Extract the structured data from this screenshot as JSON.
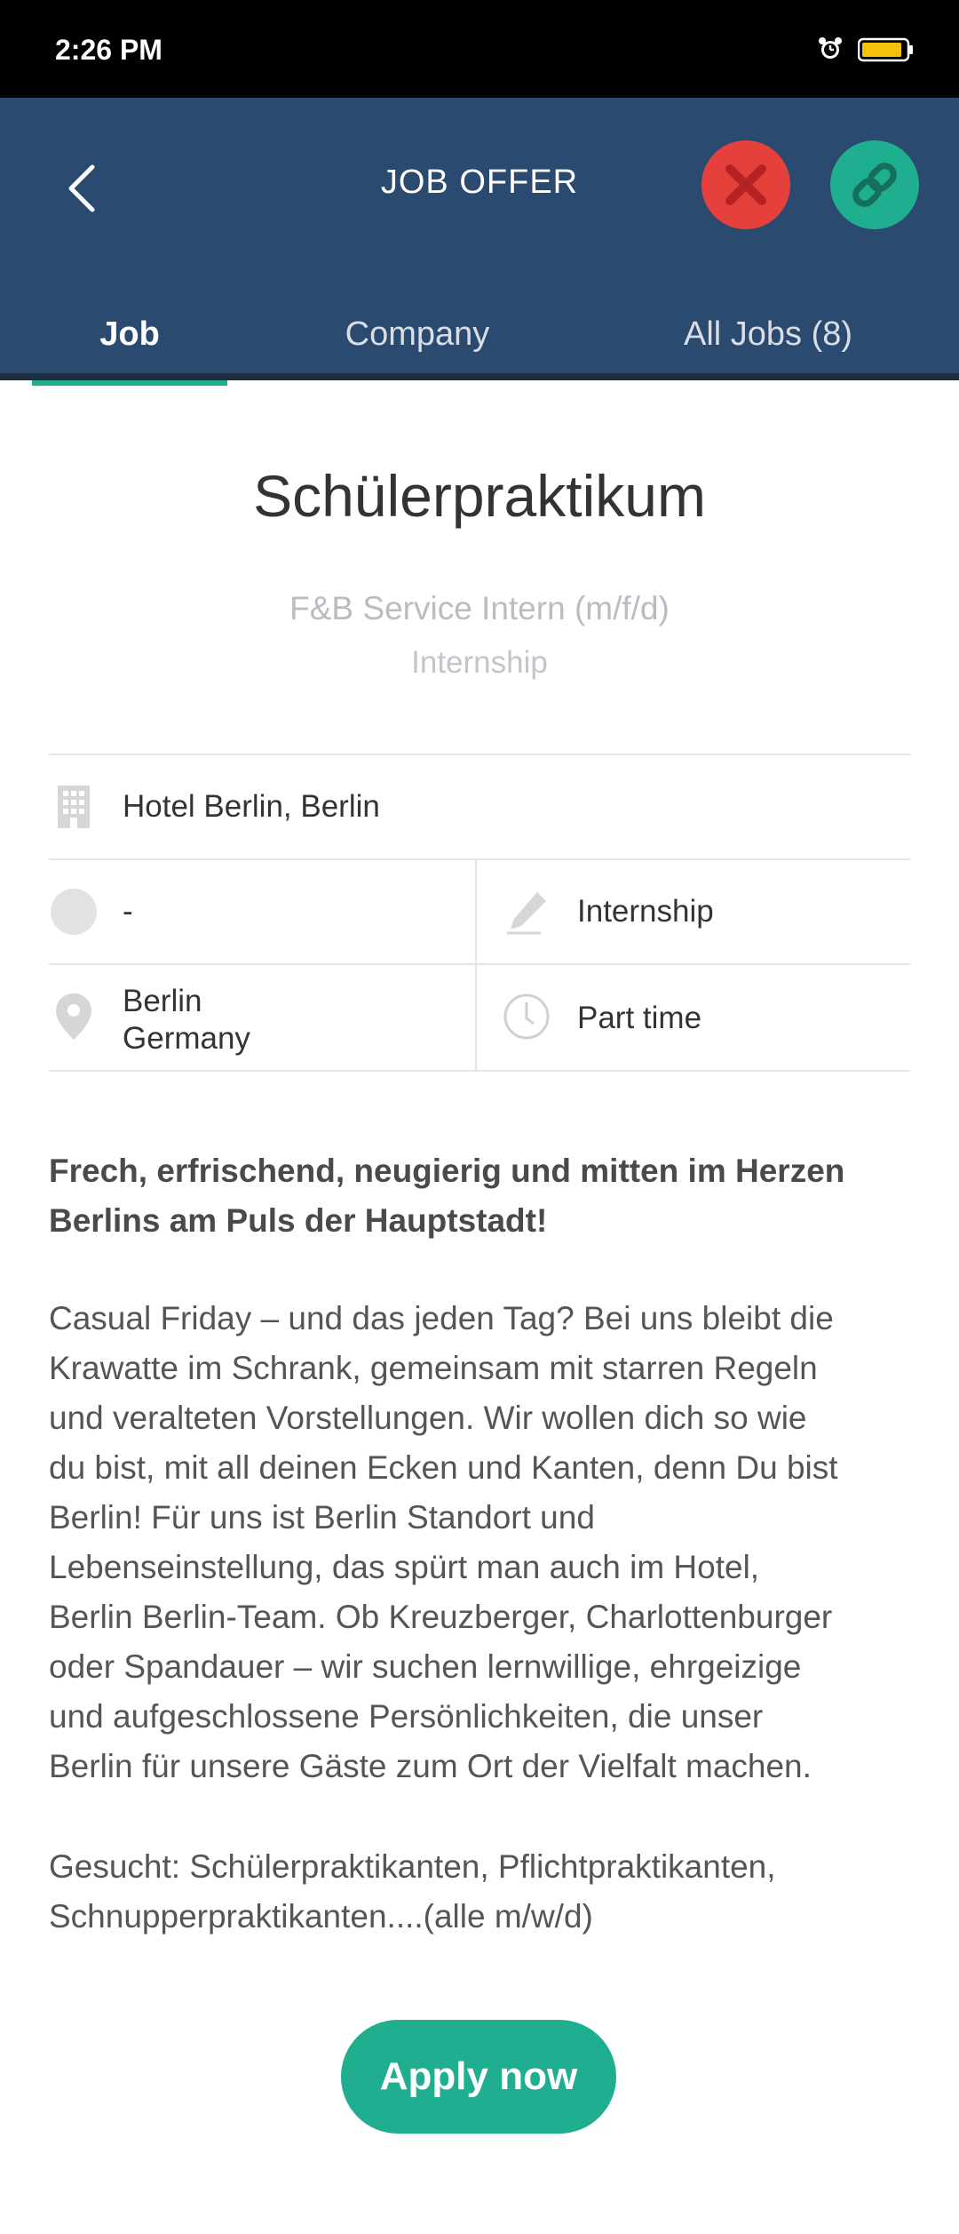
{
  "status_bar": {
    "time": "2:26 PM",
    "alarm_icon": "alarm-icon",
    "battery_icon": "battery-icon"
  },
  "header": {
    "title": "JOB OFFER",
    "back_icon": "chevron-left-icon",
    "close_icon": "close-icon",
    "link_icon": "link-icon",
    "colors": {
      "bar": "#2b4a6f",
      "close": "#e6403c",
      "link": "#1fae8f",
      "accent": "#1fae8f"
    }
  },
  "tabs": [
    {
      "label": "Job",
      "active": true
    },
    {
      "label": "Company",
      "active": false
    },
    {
      "label": "All Jobs (8)",
      "active": false
    }
  ],
  "job": {
    "title": "Schülerpraktikum",
    "subtitle": "F&B Service Intern (m/f/d)",
    "type": "Internship"
  },
  "info": {
    "hotel": {
      "icon": "building-icon",
      "text": "Hotel Berlin, Berlin"
    },
    "salary": {
      "icon": "coin-icon",
      "text": "-"
    },
    "contract": {
      "icon": "pen-icon",
      "text": "Internship"
    },
    "location": {
      "icon": "location-pin-icon",
      "line1": "Berlin",
      "line2": "Germany"
    },
    "hours": {
      "icon": "clock-icon",
      "text": "Part time"
    }
  },
  "description": {
    "headline_line1": "Frech, erfrischend, neugierig und mitten im Herzen",
    "headline_line2": "Berlins am Puls der Hauptstadt!",
    "body_lines": [
      "Casual Friday – und das jeden Tag? Bei uns bleibt die",
      "Krawatte im Schrank, gemeinsam mit starren Regeln",
      "und veralteten Vorstellungen. Wir wollen dich so wie",
      "du bist, mit all deinen Ecken und Kanten, denn Du bist",
      "Berlin! Für uns ist Berlin Standort und",
      "Lebenseinstellung, das spürt man auch im Hotel,",
      "Berlin Berlin-Team. Ob Kreuzberger, Charlottenburger",
      "oder Spandauer – wir suchen lernwillige, ehrgeizige",
      "und aufgeschlossene Persönlichkeiten, die unser",
      "Berlin für unsere Gäste zum Ort der Vielfalt machen."
    ],
    "wanted_line1": "Gesucht: Schülerpraktikanten, Pflichtpraktikanten,",
    "wanted_line2": "Schnupperpraktikanten....(alle m/w/d)"
  },
  "apply_button": {
    "label": "Apply now"
  }
}
